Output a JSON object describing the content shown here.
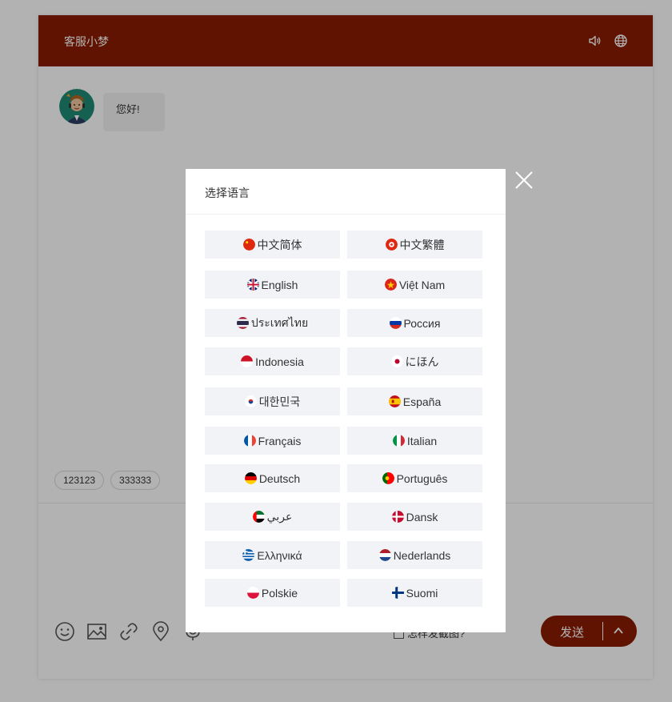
{
  "header": {
    "title": "客服小梦",
    "sound_icon": "speaker-icon",
    "language_icon": "globe-icon"
  },
  "messages": [
    {
      "text": "您好!"
    }
  ],
  "quick_replies": [
    "123123",
    "333333"
  ],
  "toolbar": {
    "icons": [
      "smile-icon",
      "image-icon",
      "link-icon",
      "location-icon",
      "microphone-icon"
    ],
    "screenshot_hint": "怎样发截图?",
    "send_label": "发送"
  },
  "modal": {
    "title": "选择语言",
    "languages": [
      {
        "label": "中文简体"
      },
      {
        "label": "中文繁體"
      },
      {
        "label": "English"
      },
      {
        "label": "Việt Nam"
      },
      {
        "label": "ประเทศไทย"
      },
      {
        "label": "Россия"
      },
      {
        "label": "Indonesia"
      },
      {
        "label": "にほん"
      },
      {
        "label": "대한민국"
      },
      {
        "label": "España"
      },
      {
        "label": "Français"
      },
      {
        "label": "Italian"
      },
      {
        "label": "Deutsch"
      },
      {
        "label": "Português"
      },
      {
        "label": "عربي"
      },
      {
        "label": "Dansk"
      },
      {
        "label": "Ελληνικά"
      },
      {
        "label": "Nederlands"
      },
      {
        "label": "Polskie"
      },
      {
        "label": "Suomi"
      }
    ]
  },
  "colors": {
    "brand": "#8a1c00",
    "lang_button_bg": "#f2f3f7",
    "overlay": "rgba(0,0,0,0.30)"
  }
}
